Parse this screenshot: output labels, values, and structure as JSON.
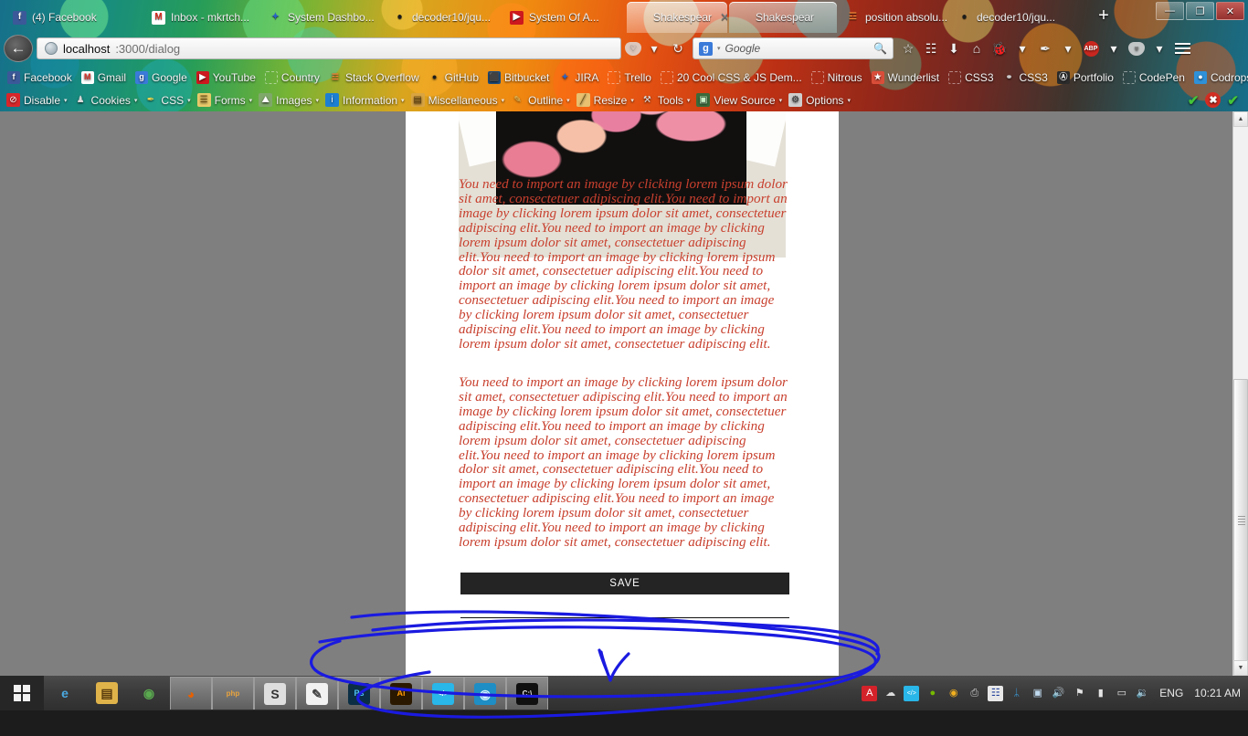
{
  "window": {
    "title": "localhost:3000/dialog",
    "controls": {
      "minimize": "—",
      "restore": "❐",
      "close": "✕"
    }
  },
  "tabs": [
    {
      "label": "(4) Facebook",
      "icon": "facebook-icon",
      "glyph": "f",
      "bg": "#3b5998",
      "fg": "#ffffff",
      "state": ""
    },
    {
      "label": "Inbox - mkrtch...",
      "icon": "gmail-icon",
      "glyph": "M",
      "bg": "#ffffff",
      "fg": "#d93025",
      "state": ""
    },
    {
      "label": "System Dashbo...",
      "icon": "jira-icon",
      "glyph": "✦",
      "bg": "transparent",
      "fg": "#2a63c7",
      "state": ""
    },
    {
      "label": "decoder10/jqu...",
      "icon": "github-icon",
      "glyph": "●",
      "bg": "transparent",
      "fg": "#1b1b1b",
      "state": ""
    },
    {
      "label": "System Of A...",
      "icon": "youtube-icon",
      "glyph": "▶",
      "bg": "#cc181e",
      "fg": "#ffffff",
      "state": ""
    },
    {
      "label": "Shakespear",
      "icon": "page-icon",
      "glyph": "",
      "bg": "transparent",
      "fg": "#ffffff",
      "state": "active"
    },
    {
      "label": "Shakespear",
      "icon": "page-icon",
      "glyph": "",
      "bg": "transparent",
      "fg": "#ffffff",
      "state": "selected"
    },
    {
      "label": "position absolu...",
      "icon": "stackoverflow-icon",
      "glyph": "☲",
      "bg": "transparent",
      "fg": "#ef8236",
      "state": ""
    },
    {
      "label": "decoder10/jqu...",
      "icon": "github-icon",
      "glyph": "●",
      "bg": "transparent",
      "fg": "#1b1b1b",
      "state": ""
    }
  ],
  "new_tab_label": "+",
  "navbar": {
    "back_glyph": "←",
    "url_host": "localhost",
    "url_path": ":3000/dialog",
    "search_engine": "Google",
    "search_engine_glyph": "g",
    "search_placeholder": "Google",
    "icons": [
      {
        "name": "pocket-icon",
        "glyph": "♡"
      },
      {
        "name": "pocket-dropdown-icon",
        "glyph": "▾"
      },
      {
        "name": "reload-icon",
        "glyph": "↻"
      }
    ],
    "right_icons": [
      {
        "name": "bookmark-star-icon",
        "glyph": "☆"
      },
      {
        "name": "reading-list-icon",
        "glyph": "☷"
      },
      {
        "name": "downloads-icon",
        "glyph": "⬇"
      },
      {
        "name": "home-icon",
        "glyph": "⌂"
      },
      {
        "name": "firebug-icon",
        "glyph": "🐞"
      },
      {
        "name": "firebug-dropdown-icon",
        "glyph": "▾"
      },
      {
        "name": "colorzilla-icon",
        "glyph": "✒"
      },
      {
        "name": "colorzilla-dropdown-icon",
        "glyph": "▾"
      },
      {
        "name": "adblock-plus-icon",
        "glyph": "ABP"
      },
      {
        "name": "adblock-dropdown-icon",
        "glyph": "▾"
      },
      {
        "name": "pocket-save-icon",
        "glyph": "⌵"
      },
      {
        "name": "pocket-save-dropdown-icon",
        "glyph": "▾"
      },
      {
        "name": "menu-hamburger-icon",
        "glyph": "☰"
      }
    ]
  },
  "bookmarks": [
    {
      "label": "Facebook",
      "icon": "facebook-icon",
      "glyph": "f",
      "bg": "#3b5998",
      "fg": "#ffffff"
    },
    {
      "label": "Gmail",
      "icon": "gmail-icon",
      "glyph": "M",
      "bg": "#ffffff",
      "fg": "#d93025"
    },
    {
      "label": "Google",
      "icon": "google-icon",
      "glyph": "g",
      "bg": "#3a7ad9",
      "fg": "#ffffff"
    },
    {
      "label": "YouTube",
      "icon": "youtube-icon",
      "glyph": "▶",
      "bg": "#cc181e",
      "fg": "#ffffff"
    },
    {
      "label": "Country",
      "icon": "blank-favicon-icon",
      "glyph": "",
      "bg": "transparent",
      "fg": "#ffffff"
    },
    {
      "label": "Stack Overflow",
      "icon": "stackoverflow-icon",
      "glyph": "☲",
      "bg": "transparent",
      "fg": "#ef8236"
    },
    {
      "label": "GitHub",
      "icon": "github-icon",
      "glyph": "●",
      "bg": "transparent",
      "fg": "#1b1b1b"
    },
    {
      "label": "Bitbucket",
      "icon": "bitbucket-icon",
      "glyph": "⬛",
      "bg": "#205081",
      "fg": "#ffffff"
    },
    {
      "label": "JIRA",
      "icon": "jira-icon",
      "glyph": "✦",
      "bg": "transparent",
      "fg": "#2a63c7"
    },
    {
      "label": "Trello",
      "icon": "blank-favicon-icon",
      "glyph": "",
      "bg": "transparent",
      "fg": "#ffffff"
    },
    {
      "label": "20 Cool CSS & JS Dem...",
      "icon": "blank-favicon-icon",
      "glyph": "",
      "bg": "transparent",
      "fg": "#ffffff"
    },
    {
      "label": "Nitrous",
      "icon": "blank-favicon-icon",
      "glyph": "",
      "bg": "transparent",
      "fg": "#ffffff"
    },
    {
      "label": "Wunderlist",
      "icon": "wunderlist-icon",
      "glyph": "★",
      "bg": "#da4d39",
      "fg": "#ffffff"
    },
    {
      "label": "CSS3",
      "icon": "blank-favicon-icon",
      "glyph": "",
      "bg": "transparent",
      "fg": "#ffffff"
    },
    {
      "label": "CSS3",
      "icon": "link-icon",
      "glyph": "⚭",
      "bg": "transparent",
      "fg": "#d9d9d9"
    },
    {
      "label": "Portfolio",
      "icon": "portfolio-icon",
      "glyph": "Ⓐ",
      "bg": "#2b2b2b",
      "fg": "#ffffff"
    },
    {
      "label": "CodePen",
      "icon": "blank-favicon-icon",
      "glyph": "",
      "bg": "transparent",
      "fg": "#ffffff"
    },
    {
      "label": "Codrops",
      "icon": "codrops-icon",
      "glyph": "●",
      "bg": "#2f91d8",
      "fg": "#ffffff"
    }
  ],
  "bookmarks_overflow_label": "»",
  "devtoolbar": {
    "items": [
      {
        "label": "Disable",
        "icon": "disable-icon",
        "glyph": "⊘",
        "bg": "#d8262a",
        "fg": "#ffffff",
        "caret": true
      },
      {
        "label": "Cookies",
        "icon": "cookies-icon",
        "glyph": "♟",
        "bg": "transparent",
        "fg": "#dadada",
        "caret": true
      },
      {
        "label": "CSS",
        "icon": "css-icon",
        "glyph": "✒",
        "bg": "transparent",
        "fg": "#f2d94e",
        "caret": true
      },
      {
        "label": "Forms",
        "icon": "forms-icon",
        "glyph": "☰",
        "bg": "#e8c96a",
        "fg": "#6a4f12",
        "caret": true
      },
      {
        "label": "Images",
        "icon": "images-icon",
        "glyph": "⛰",
        "bg": "#7fa86a",
        "fg": "#ffffff",
        "caret": true
      },
      {
        "label": "Information",
        "icon": "information-icon",
        "glyph": "i",
        "bg": "#1d7fd1",
        "fg": "#ffffff",
        "caret": true
      },
      {
        "label": "Miscellaneous",
        "icon": "miscellaneous-icon",
        "glyph": "▤",
        "bg": "#d9a441",
        "fg": "#5a3c0e",
        "caret": true
      },
      {
        "label": "Outline",
        "icon": "outline-icon",
        "glyph": "✎",
        "bg": "transparent",
        "fg": "#e8c96a",
        "caret": true
      },
      {
        "label": "Resize",
        "icon": "resize-icon",
        "glyph": "╱",
        "bg": "#e8c070",
        "fg": "#6a4f12",
        "caret": true
      },
      {
        "label": "Tools",
        "icon": "tools-icon",
        "glyph": "⚒",
        "bg": "transparent",
        "fg": "#dedede",
        "caret": true
      },
      {
        "label": "View Source",
        "icon": "view-source-icon",
        "glyph": "▣",
        "bg": "#3a6a3a",
        "fg": "#c8f0c8",
        "caret": true
      },
      {
        "label": "Options",
        "icon": "options-icon",
        "glyph": "⚙",
        "bg": "#cfcfcf",
        "fg": "#333333",
        "caret": true
      }
    ],
    "status": [
      {
        "name": "validation-pass-icon",
        "glyph": "✔"
      },
      {
        "name": "validation-error-icon",
        "glyph": "✖"
      },
      {
        "name": "validation-pass-2-icon",
        "glyph": "✔"
      }
    ]
  },
  "page": {
    "hero_alt": "floral-artwork-thumbnail",
    "paragraph1": "You need to import an image by clicking lorem ipsum dolor sit amet, consectetuer adipiscing elit.You need to import an image by clicking lorem ipsum dolor sit amet, consectetuer adipiscing elit.You need to import an image by clicking lorem ipsum dolor sit amet, consectetuer adipiscing elit.You need to import an image by clicking lorem ipsum dolor sit amet, consectetuer adipiscing elit.You need to import an image by clicking lorem ipsum dolor sit amet, consectetuer adipiscing elit.You need to import an image by clicking lorem ipsum dolor sit amet, consectetuer adipiscing elit.You need to import an image by clicking lorem ipsum dolor sit amet, consectetuer adipiscing elit.",
    "paragraph2": "You need to import an image by clicking lorem ipsum dolor sit amet, consectetuer adipiscing elit.You need to import an image by clicking lorem ipsum dolor sit amet, consectetuer adipiscing elit.You need to import an image by clicking lorem ipsum dolor sit amet, consectetuer adipiscing elit.You need to import an image by clicking lorem ipsum dolor sit amet, consectetuer adipiscing elit.You need to import an image by clicking lorem ipsum dolor sit amet, consectetuer adipiscing elit.You need to import an image by clicking lorem ipsum dolor sit amet, consectetuer adipiscing elit.You need to import an image by clicking lorem ipsum dolor sit amet, consectetuer adipiscing elit.",
    "save_label": "SAVE",
    "text_color": "#c8402e",
    "save_bg": "#242424"
  },
  "scrollbar": {
    "up_glyph": "▲",
    "down_glyph": "▼"
  },
  "taskbar": {
    "start_label": "Start",
    "items": [
      {
        "name": "internet-explorer-icon",
        "glyph": "e",
        "bg": "transparent",
        "fg": "#4aa8e0",
        "running": false
      },
      {
        "name": "file-explorer-icon",
        "glyph": "▤",
        "bg": "#e0b34a",
        "fg": "#5a3c0e",
        "running": false
      },
      {
        "name": "chrome-icon",
        "glyph": "◉",
        "bg": "transparent",
        "fg": "#5aa94f",
        "running": false
      },
      {
        "name": "firefox-icon",
        "glyph": "◕",
        "bg": "transparent",
        "fg": "#e66000",
        "running": true
      },
      {
        "name": "php-storm-icon",
        "glyph": "php",
        "bg": "transparent",
        "fg": "#e8a33d",
        "running": true
      },
      {
        "name": "sublime-text-icon",
        "glyph": "S",
        "bg": "#dedede",
        "fg": "#333333",
        "running": true
      },
      {
        "name": "notepad-icon",
        "glyph": "✎",
        "bg": "#f2f2f2",
        "fg": "#444444",
        "running": true
      },
      {
        "name": "photoshop-icon",
        "glyph": "Ps",
        "bg": "#0b2e44",
        "fg": "#4fc3f7",
        "running": true
      },
      {
        "name": "illustrator-icon",
        "glyph": "Ai",
        "bg": "#2b1800",
        "fg": "#ff9a00",
        "running": true
      },
      {
        "name": "code-editor-icon",
        "glyph": "</>",
        "bg": "#29b6e8",
        "fg": "#ffffff",
        "running": true
      },
      {
        "name": "dev-tool-icon",
        "glyph": "◉",
        "bg": "#1f8ec4",
        "fg": "#d8f2ff",
        "running": true
      },
      {
        "name": "command-prompt-icon",
        "glyph": "C:\\",
        "bg": "#101010",
        "fg": "#e8e8e8",
        "running": true
      }
    ],
    "tray": [
      {
        "name": "adobe-creative-cloud-icon",
        "glyph": "A",
        "bg": "#d4222a",
        "fg": "#ffffff"
      },
      {
        "name": "onedrive-cloud-icon",
        "glyph": "☁",
        "bg": "transparent",
        "fg": "#dcdcdc"
      },
      {
        "name": "code-tray-icon",
        "glyph": "</>",
        "bg": "#29b6e8",
        "fg": "#ffffff"
      },
      {
        "name": "nvidia-icon",
        "glyph": "●",
        "bg": "transparent",
        "fg": "#76b900"
      },
      {
        "name": "chrome-tray-icon",
        "glyph": "◉",
        "bg": "transparent",
        "fg": "#f2b01e"
      },
      {
        "name": "printer-icon",
        "glyph": "⎙",
        "bg": "transparent",
        "fg": "#cfcfcf"
      },
      {
        "name": "keyboard-layout-flag-icon",
        "glyph": "☷",
        "bg": "#e8e8e8",
        "fg": "#20409a"
      },
      {
        "name": "bluetooth-icon",
        "glyph": "ᛦ",
        "bg": "transparent",
        "fg": "#3aa3e8"
      },
      {
        "name": "display-settings-icon",
        "glyph": "▣",
        "bg": "transparent",
        "fg": "#bfd9ee"
      },
      {
        "name": "volume-icon",
        "glyph": "🔊",
        "bg": "transparent",
        "fg": "#d93025"
      },
      {
        "name": "action-center-flag-icon",
        "glyph": "⚑",
        "bg": "transparent",
        "fg": "#e4e4e4"
      },
      {
        "name": "network-icon",
        "glyph": "▮",
        "bg": "transparent",
        "fg": "#e4e4e4"
      },
      {
        "name": "battery-icon",
        "glyph": "▭",
        "bg": "transparent",
        "fg": "#e4e4e4"
      },
      {
        "name": "speaker-tray-icon",
        "glyph": "🔉",
        "bg": "transparent",
        "fg": "#e4e4e4"
      }
    ],
    "language": "ENG",
    "clock": "10:21 AM"
  },
  "annotation": {
    "color": "#1a1ae0",
    "description": "hand-drawn blue circle and arrow markup"
  }
}
